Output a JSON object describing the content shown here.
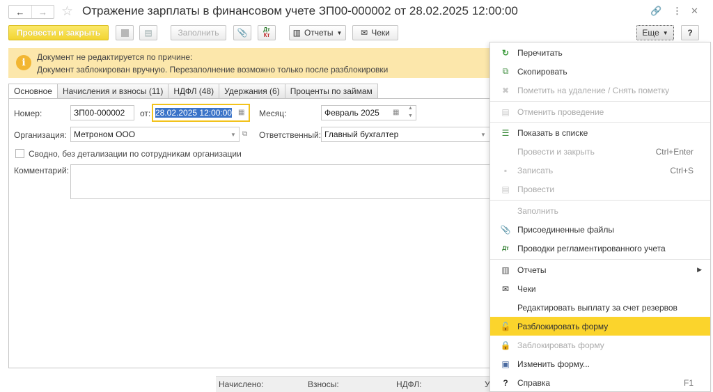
{
  "window": {
    "title": "Отражение зарплаты в финансовом учете ЗП00-000002 от 28.02.2025 12:00:00",
    "back_icon": "←",
    "forward_icon": "→"
  },
  "toolbar": {
    "post_close": "Провести и закрыть",
    "fill": "Заполнить",
    "reports": "Отчеты",
    "checks": "Чеки",
    "more": "Еще",
    "help": "?",
    "dt_kt_top": "Дт",
    "dt_kt_bottom": "Кт"
  },
  "banner": {
    "line1": "Документ не редактируется по причине:",
    "line2": "Документ заблокирован вручную. Перезаполнение возможно только после разблокировки"
  },
  "tabs": [
    {
      "label": "Основное"
    },
    {
      "label": "Начисления и взносы (11)"
    },
    {
      "label": "НДФЛ (48)"
    },
    {
      "label": "Удержания (6)"
    },
    {
      "label": "Проценты по займам"
    }
  ],
  "form": {
    "number_label": "Номер:",
    "number_value": "ЗП00-000002",
    "date_label": "от:",
    "date_value": "28.02.2025 12:00:00",
    "month_label": "Месяц:",
    "month_value": "Февраль 2025",
    "org_label": "Организация:",
    "org_value": "Метроном ООО",
    "resp_label": "Ответственный:",
    "resp_value": "Главный бухгалтер",
    "summary_label": "Сводно, без детализации по сотрудникам организации",
    "comment_label": "Комментарий:"
  },
  "footer": {
    "accrued": "Начислено:",
    "contributions": "Взносы:",
    "ndfl": "НДФЛ:",
    "cut": "У"
  },
  "menu": {
    "items": [
      {
        "label": "Перечитать",
        "icon": "↻"
      },
      {
        "label": "Скопировать",
        "icon": "⧉"
      },
      {
        "label": "Пометить на удаление / Снять пометку",
        "icon": "✖"
      },
      {
        "label": "Отменить проведение",
        "icon": "▤"
      },
      {
        "label": "Показать в списке",
        "icon": "☰"
      },
      {
        "label": "Провести и закрыть",
        "shortcut": "Ctrl+Enter"
      },
      {
        "label": "Записать",
        "shortcut": "Ctrl+S",
        "icon": "▪"
      },
      {
        "label": "Провести",
        "icon": "▤"
      },
      {
        "label": "Заполнить"
      },
      {
        "label": "Присоединенные файлы",
        "icon": "📎"
      },
      {
        "label": "Проводки регламентированного учета",
        "icon": "Дт"
      },
      {
        "label": "Отчеты",
        "icon": "▥"
      },
      {
        "label": "Чеки",
        "icon": "✉"
      },
      {
        "label": "Редактировать выплату за счет резервов"
      },
      {
        "label": "Разблокировать форму",
        "icon": "🔓"
      },
      {
        "label": "Заблокировать форму",
        "icon": "🔒"
      },
      {
        "label": "Изменить форму...",
        "icon": "▣"
      },
      {
        "label": "Справка",
        "shortcut": "F1",
        "icon": "?"
      }
    ]
  }
}
